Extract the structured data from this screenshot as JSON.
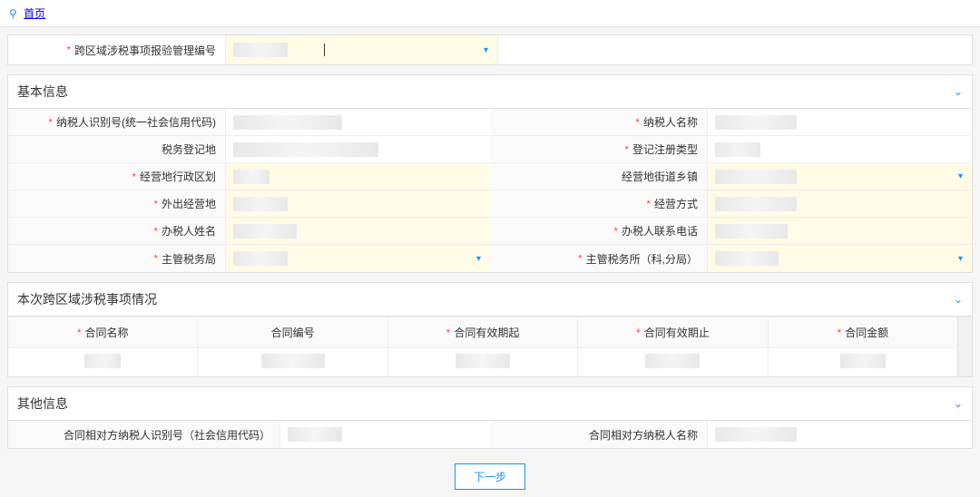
{
  "breadcrumb": {
    "home": "首页"
  },
  "top": {
    "mgmt_number_label": "跨区域涉税事项报验管理编号"
  },
  "section_basic": {
    "title": "基本信息",
    "taxpayer_id_label": "纳税人识别号(统一社会信用代码)",
    "taxpayer_name_label": "纳税人名称",
    "tax_reg_place_label": "税务登记地",
    "reg_type_label": "登记注册类型",
    "biz_area_label": "经营地行政区划",
    "biz_street_label": "经营地街道乡镇",
    "outbound_biz_label": "外出经营地",
    "biz_method_label": "经营方式",
    "agent_name_label": "办税人姓名",
    "agent_phone_label": "办税人联系电话",
    "tax_bureau_label": "主管税务局",
    "tax_office_label": "主管税务所（科,分局）"
  },
  "section_contract": {
    "title": "本次跨区域涉税事项情况",
    "col_name": "合同名称",
    "col_number": "合同编号",
    "col_start": "合同有效期起",
    "col_end": "合同有效期止",
    "col_amount": "合同金额"
  },
  "section_other": {
    "title": "其他信息",
    "counterpart_id_label": "合同相对方纳税人识别号（社会信用代码）",
    "counterpart_name_label": "合同相对方纳税人名称"
  },
  "buttons": {
    "next": "下一步"
  }
}
